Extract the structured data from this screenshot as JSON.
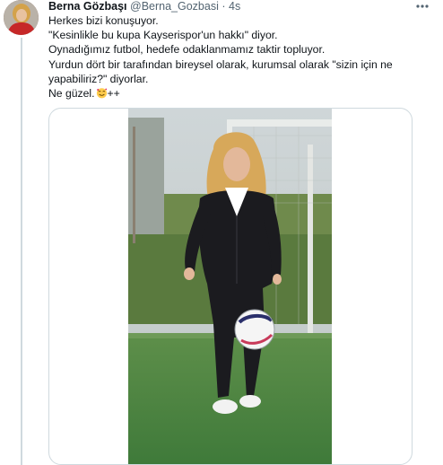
{
  "tweet": {
    "author_name": "Berna Gözbaşı",
    "author_handle": "@Berna_Gozbasi",
    "separator": "·",
    "time": "4s",
    "lines": [
      "Herkes bizi konuşuyor.",
      "\"Kesinlikle bu kupa Kayserispor'un hakkı\" diyor.",
      "Oynadığımız futbol, hedefe odaklanmamız taktir topluyor.",
      "Yurdun dört bir tarafından bireysel olarak, kurumsal olarak \"sizin için ne",
      "yapabiliriz?\" diyorlar."
    ],
    "last_line_text": "Ne güzel.",
    "last_line_suffix": "++",
    "last_line_emoji": "smiling-face-with-hearts-emoji"
  },
  "icons": {
    "more": "more-horizontal-icon"
  },
  "colors": {
    "text": "#0f1419",
    "secondary": "#536471",
    "border": "#cfd9de",
    "grass": "#3f7a3a",
    "tracksuit": "#1b1b1f"
  }
}
